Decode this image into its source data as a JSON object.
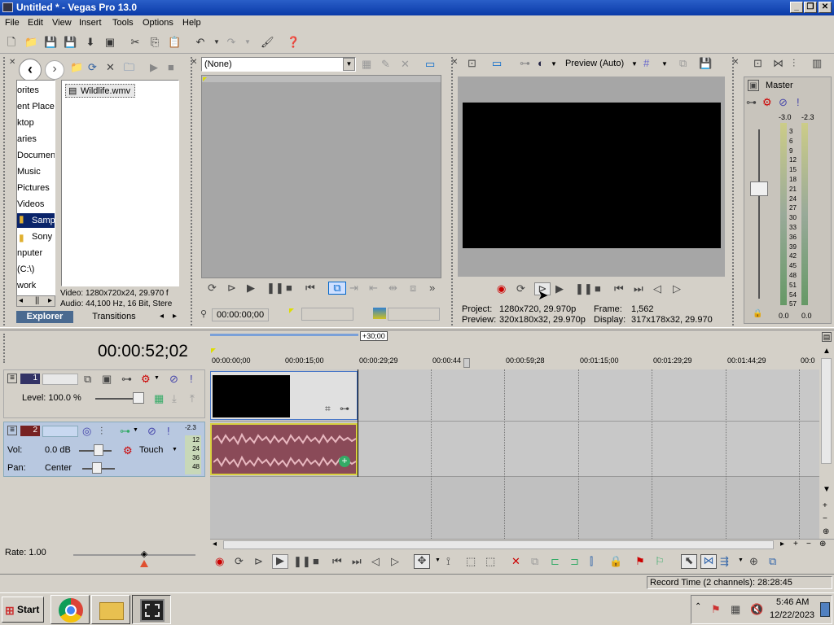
{
  "window": {
    "title": "Untitled * - Vegas Pro 13.0",
    "minimize": "_",
    "restore": "❐",
    "close": "✕"
  },
  "menu": [
    "File",
    "Edit",
    "View",
    "Insert",
    "Tools",
    "Options",
    "Help"
  ],
  "explorer": {
    "tree": [
      "orites",
      "ent Places",
      "ktop",
      "aries",
      "Documen",
      "Music",
      "Pictures",
      "Videos",
      "Samp",
      "Sony",
      "nputer",
      "(C:\\)",
      "work"
    ],
    "file": "Wildlife.wmv",
    "info_video": "Video: 1280x720x24, 29.970 f",
    "info_audio": "Audio: 44,100 Hz, 16 Bit, Stere",
    "tabs": [
      "Explorer",
      "Transitions"
    ]
  },
  "trimmer": {
    "dropdown": "(None)",
    "timecode": "00:00:00;00"
  },
  "preview": {
    "mode": "Preview (Auto)",
    "project_label": "Project:",
    "project_value": "1280x720, 29.970p",
    "preview_label": "Preview:",
    "preview_value": "320x180x32, 29.970p",
    "frame_label": "Frame:",
    "frame_value": "1,562",
    "display_label": "Display:",
    "display_value": "317x178x32, 29.970"
  },
  "master": {
    "label": "Master",
    "left_peak": "-3.0",
    "right_peak": "-2.3",
    "scale": [
      "3",
      "6",
      "9",
      "12",
      "15",
      "18",
      "21",
      "24",
      "27",
      "30",
      "33",
      "36",
      "39",
      "42",
      "45",
      "48",
      "51",
      "54",
      "57"
    ],
    "left_val": "0.0",
    "right_val": "0.0"
  },
  "timeline": {
    "timecode": "00:00:52;02",
    "loop_marker": "+30;00",
    "ruler": [
      "00:00:00;00",
      "00:00:15;00",
      "00:00:29;29",
      "00:00:44",
      "00:00:59;28",
      "00:01:15;00",
      "00:01:29;29",
      "00:01:44;29",
      "00:0"
    ],
    "track1": {
      "num": "1",
      "level": "Level: 100.0 %"
    },
    "track2": {
      "num": "2",
      "vol_label": "Vol:",
      "vol_value": "0.0 dB",
      "pan_label": "Pan:",
      "pan_value": "Center",
      "automation": "Touch",
      "meter_peak": "-2.3",
      "meter_scale": [
        "12",
        "24",
        "36",
        "48"
      ]
    },
    "rate": "Rate: 1.00",
    "record_time": "Record Time (2 channels): 28:28:45"
  },
  "taskbar": {
    "start": "Start",
    "time": "5:46 AM",
    "date": "12/22/2023"
  }
}
